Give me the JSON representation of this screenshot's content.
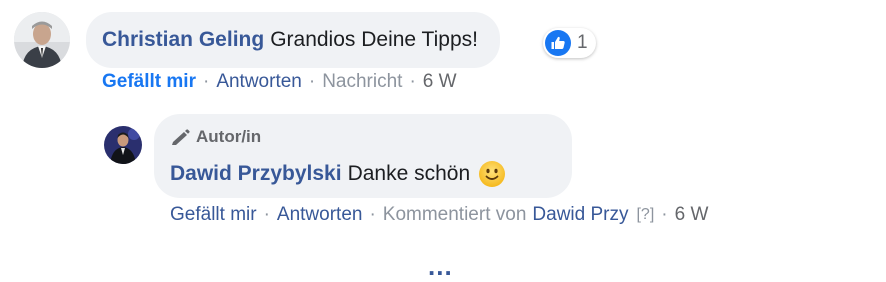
{
  "comment": {
    "author": "Christian Geling",
    "text": "Grandios Deine Tipps!",
    "reaction_icon": "like-icon",
    "reaction_count": "1",
    "actions": {
      "like": "Gefällt mir",
      "reply": "Antworten",
      "message": "Nachricht",
      "time": "6 W"
    }
  },
  "reply": {
    "author_tag": "Autor/in",
    "author": "Dawid Przybylski",
    "text": "Danke schön",
    "emoji_icon": "smiling-face-icon",
    "actions": {
      "like": "Gefällt mir",
      "reply": "Antworten",
      "commented_by_prefix": "Kommentiert von",
      "commented_by_name": "Dawid Przy",
      "help": "[?]",
      "time": "6 W"
    }
  },
  "more_replies": "...",
  "separator": "·",
  "colors": {
    "name_blue": "#385898",
    "like_blue": "#1877f2",
    "bubble_bg": "#f0f2f5",
    "muted_text": "#65676b"
  }
}
